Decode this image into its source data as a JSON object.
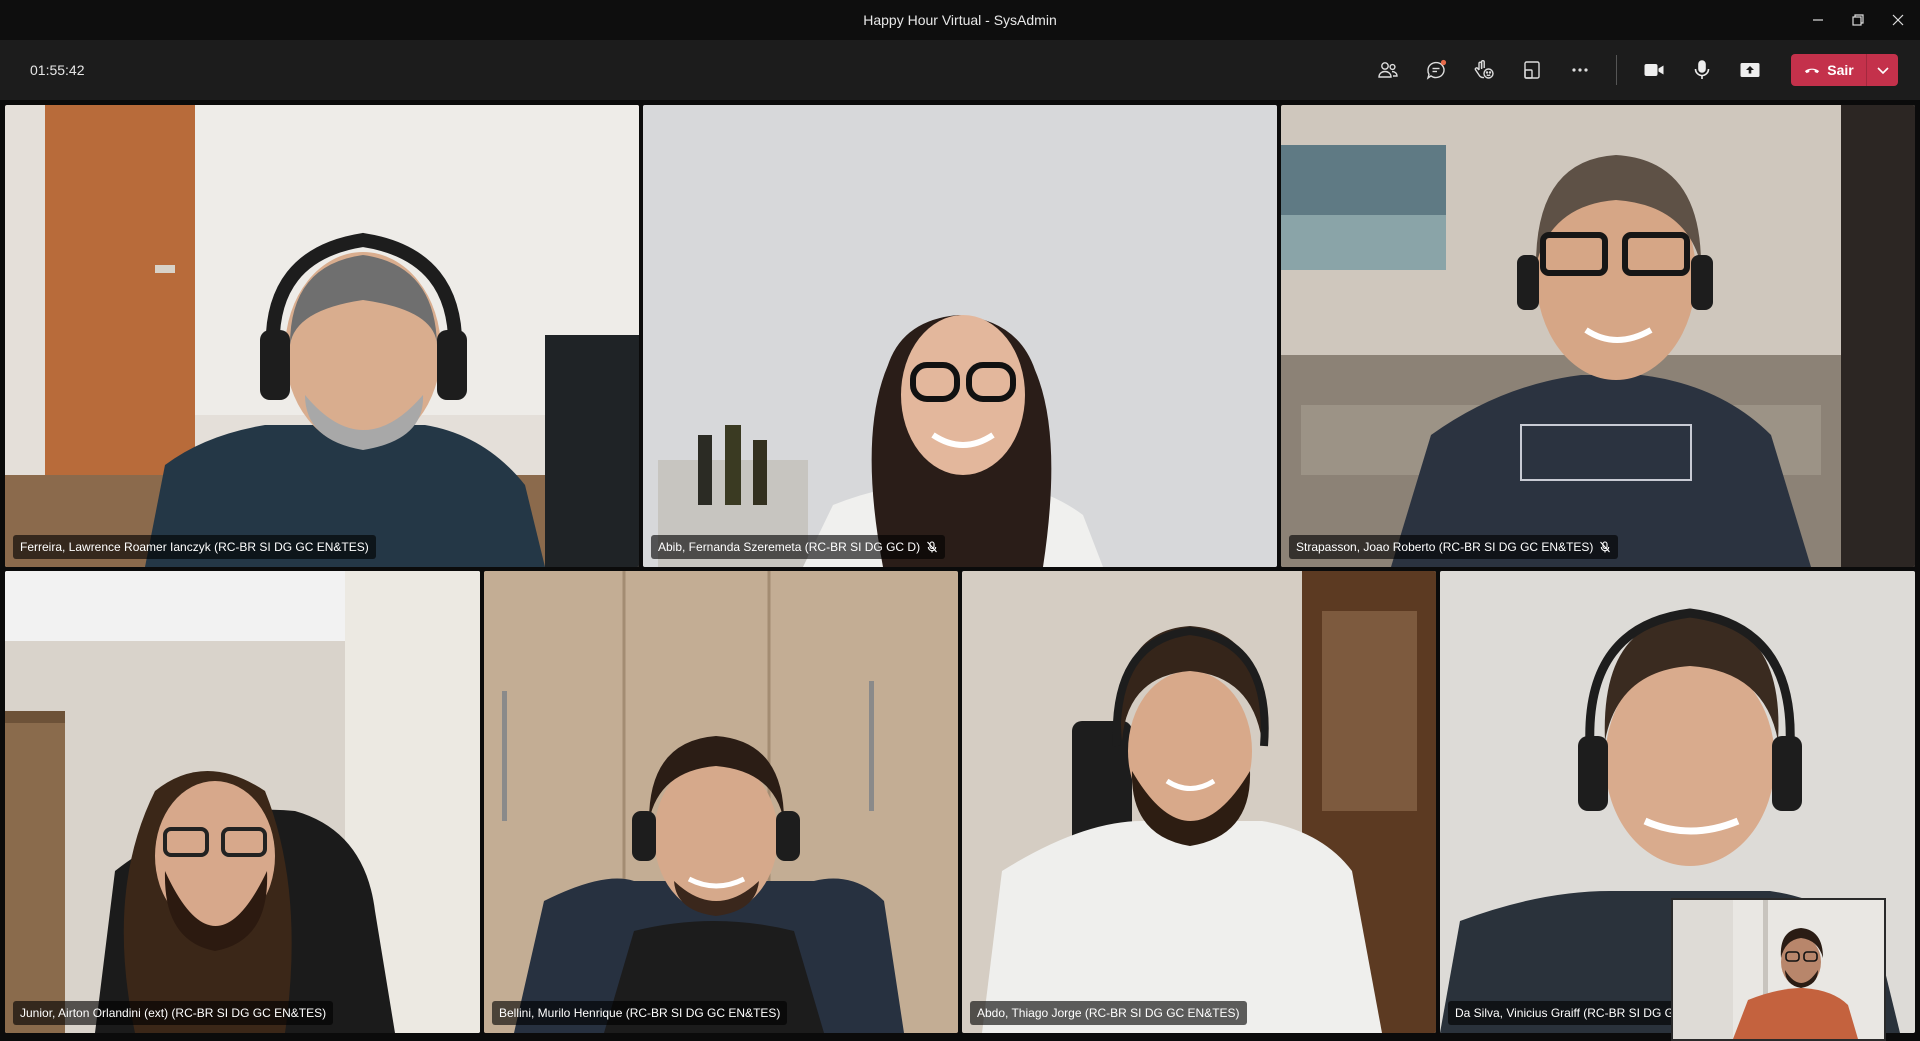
{
  "window": {
    "title": "Happy Hour Virtual - SysAdmin"
  },
  "toolbar": {
    "timer": "01:55:42",
    "leave_label": "Sair",
    "icons": [
      "participants-icon",
      "chat-icon",
      "reactions-icon",
      "room-view-icon",
      "more-icon",
      "camera-icon",
      "microphone-icon",
      "share-screen-icon",
      "phone-hangup-icon",
      "chevron-down-icon"
    ]
  },
  "participants": [
    {
      "name": "Ferreira, Lawrence Roamer Ianczyk (RC-BR SI DG GC EN&TES)",
      "muted": false
    },
    {
      "name": "Abib, Fernanda Szeremeta (RC-BR SI DG GC D)",
      "muted": true
    },
    {
      "name": "Strapasson, Joao Roberto (RC-BR SI DG GC EN&TES)",
      "muted": true
    },
    {
      "name": "Junior, Airton Orlandini (ext) (RC-BR SI DG GC EN&TES)",
      "muted": false
    },
    {
      "name": "Bellini, Murilo Henrique (RC-BR SI DG GC EN&TES)",
      "muted": false
    },
    {
      "name": "Abdo, Thiago Jorge (RC-BR SI DG GC EN&TES)",
      "muted": false
    },
    {
      "name": "Da Silva, Vinicius Graiff (RC-BR SI DG GC EN&TES)",
      "muted": false
    }
  ],
  "colors": {
    "leave_button": "#c4314b",
    "toolbar_bg": "#1c1c1c",
    "stage_bg": "#0b0b0b",
    "chat_badge": "#e66a4a"
  }
}
